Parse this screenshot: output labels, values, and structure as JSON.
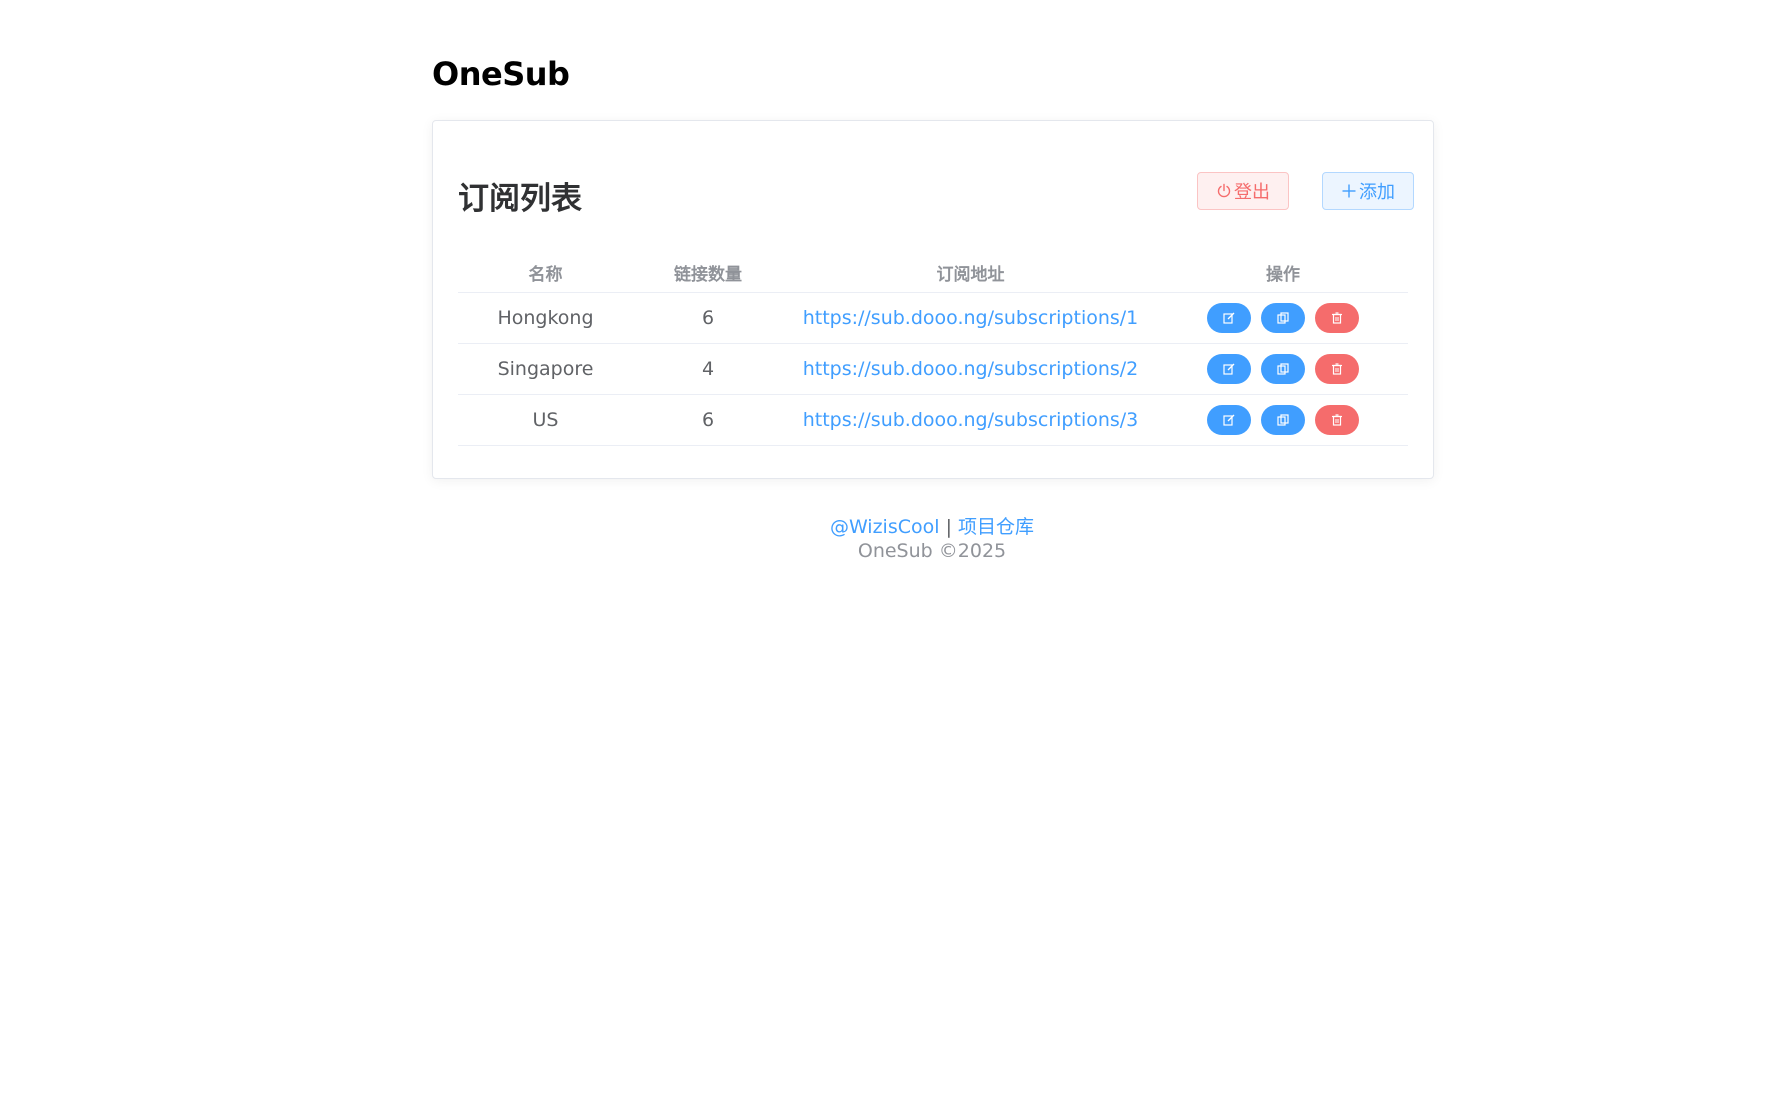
{
  "app": {
    "title": "OneSub"
  },
  "card": {
    "title": "订阅列表",
    "logout_label": "登出",
    "add_label": "添加"
  },
  "table": {
    "headers": [
      "名称",
      "链接数量",
      "订阅地址",
      "操作"
    ],
    "rows": [
      {
        "name": "Hongkong",
        "count": "6",
        "url": "https://sub.dooo.ng/subscriptions/1"
      },
      {
        "name": "Singapore",
        "count": "4",
        "url": "https://sub.dooo.ng/subscriptions/2"
      },
      {
        "name": "US",
        "count": "6",
        "url": "https://sub.dooo.ng/subscriptions/3"
      }
    ],
    "actions": [
      "edit-icon",
      "copy-icon",
      "delete-icon"
    ]
  },
  "footer": {
    "author_link": "@WizisCool",
    "separator": "|",
    "repo_link": "项目仓库",
    "copyright": "OneSub ©2025"
  },
  "colors": {
    "primary": "#409eff",
    "danger": "#f56c6c",
    "text": "#606266",
    "muted": "#909399"
  }
}
